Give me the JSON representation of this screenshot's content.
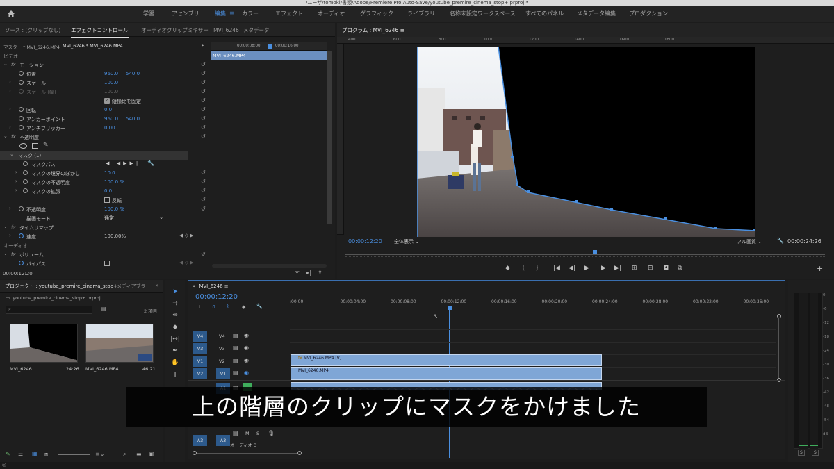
{
  "window": {
    "title": "/ユーザ/tomoki/書類/Adobe/Premiere Pro Auto-Save/youtube_premire_cinema_stop+.prproj *"
  },
  "workspaces": [
    {
      "label": "学習",
      "active": false
    },
    {
      "label": "アセンブリ",
      "active": false
    },
    {
      "label": "編集",
      "active": true
    },
    {
      "label": "カラー",
      "active": false
    },
    {
      "label": "エフェクト",
      "active": false
    },
    {
      "label": "オーディオ",
      "active": false
    },
    {
      "label": "グラフィック",
      "active": false
    },
    {
      "label": "ライブラリ",
      "active": false
    },
    {
      "label": "名称未設定ワークスペース",
      "active": false
    },
    {
      "label": "すべてのパネル",
      "active": false
    },
    {
      "label": "メタデータ編集",
      "active": false
    },
    {
      "label": "プロダクション",
      "active": false
    }
  ],
  "effect_panel": {
    "tabs": [
      "ソース : (クリップなし)",
      "エフェクトコントロール",
      "オーディオクリップミキサー : MVI_6246",
      "メタデータ"
    ],
    "master_label": "マスター * MVI_6246.MP4",
    "clip_label": "MVI_6246 * MVI_6246.MP4",
    "ruler": {
      "t1": "00:00:08:00",
      "t2": "00:00:16:00"
    },
    "clip_bar": "MVI_6246.MP4",
    "section_video": "ビデオ",
    "motion": "モーション",
    "position": {
      "label": "位置",
      "x": "960.0",
      "y": "540.0"
    },
    "scale": {
      "label": "スケール",
      "value": "100.0"
    },
    "scale_w": {
      "label": "スケール (幅)",
      "value": "100.0"
    },
    "uniform": "縦横比を固定",
    "rotation": {
      "label": "回転",
      "value": "0.0"
    },
    "anchor": {
      "label": "アンカーポイント",
      "x": "960.0",
      "y": "540.0"
    },
    "antiflicker": {
      "label": "アンチフリッカー",
      "value": "0.00"
    },
    "opacity_section": "不透明度",
    "mask": "マスク (1)",
    "mask_path": "マスクパス",
    "mask_feather": {
      "label": "マスクの境界のぼかし",
      "value": "10.0"
    },
    "mask_opacity": {
      "label": "マスクの不透明度",
      "value": "100.0 %"
    },
    "mask_expansion": {
      "label": "マスクの拡張",
      "value": "0.0"
    },
    "invert": "反転",
    "opacity": {
      "label": "不透明度",
      "value": "100.0 %"
    },
    "blend": {
      "label": "描画モード",
      "value": "通常"
    },
    "time_remap": "タイムリマップ",
    "speed": {
      "label": "速度",
      "value": "100.00%"
    },
    "section_audio": "オーディオ",
    "volume": "ボリューム",
    "bypass": "バイパス",
    "timecode": "00:00:12:20"
  },
  "program": {
    "tab": "プログラム : MVI_6246",
    "ruler": [
      "400",
      "600",
      "800",
      "1000",
      "1200",
      "1400",
      "1600",
      "1800"
    ],
    "timecode": "00:00:12:20",
    "zoom": "全体表示",
    "quality": "フル画質",
    "duration": "00:00:24:26",
    "playhead": 0.52
  },
  "project": {
    "tabs": [
      "プロジェクト : youtube_premire_cinema_stop+",
      "メディアブラ"
    ],
    "filename": "youtube_premire_cinema_stop+.prproj",
    "count": "2 項目",
    "items": [
      {
        "name": "MVI_6246",
        "duration": "24:26"
      },
      {
        "name": "MVI_6246.MP4",
        "duration": "46:21"
      }
    ]
  },
  "timeline": {
    "tab": "MVI_6246",
    "timecode": "00:00:12:20",
    "ruler": [
      ":00:00",
      "00:00:04:00",
      "00:00:08:00",
      "00:00:12:00",
      "00:00:16:00",
      "00:00:20:00",
      "00:00:24:00",
      "00:00:28:00",
      "00:00:32:00",
      "00:00:36:00"
    ],
    "tracks": {
      "v4": {
        "src": "V4",
        "name": "V4"
      },
      "v3": {
        "src": "V3",
        "name": "V3"
      },
      "v2": {
        "src": "V1",
        "name": "V2"
      },
      "v1": {
        "src": "V2",
        "name": "V1"
      },
      "a1": {
        "src": "A1",
        "name": "A1"
      },
      "a3": {
        "src": "A3",
        "name": "A3",
        "label": "オーディオ 3"
      }
    },
    "clip_top": "MVI_6246.MP4 [V]",
    "clip_bottom": "MVI_6246.MP4",
    "mute": "M",
    "solo": "S"
  },
  "meter": {
    "labels": [
      "0",
      "-6",
      "-12",
      "-18",
      "-24",
      "-30",
      "-36",
      "-42",
      "-48",
      "-54",
      "dB"
    ],
    "solo": "S"
  },
  "subtitle": "上の階層のクリップにマスクをかけました",
  "colors": {
    "accent": "#4a8fe0",
    "track_blue": "#2d5a8c",
    "clip": "#7fa6d6",
    "playhead": "#4a8fe0"
  }
}
